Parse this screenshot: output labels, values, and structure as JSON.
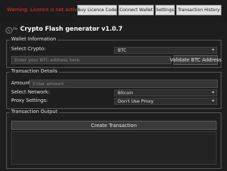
{
  "topbar": {
    "warning_text": "Warning: Licence is not activated",
    "buttons": [
      "Buy Licence Code",
      "Connect Wallet",
      "Settings",
      "Transaction History"
    ]
  },
  "header": {
    "logo_text": "lo",
    "logo_suffix": "Po",
    "title": "Crypto Flash generator v1.0.7"
  },
  "wallet": {
    "section_title": "Wallet Information",
    "select_crypto_label": "Select Crypto:",
    "crypto_value": "BTC",
    "address_placeholder": "Enter your BTC address here",
    "validate_label": "Validate BTC Address"
  },
  "transaction": {
    "section_title": "Transaction Details",
    "amount_label": "Amount:",
    "amount_placeholder": "Enter amount",
    "network_label": "Select Network:",
    "network_value": "Bitcoin",
    "proxy_label": "Proxy Settings:",
    "proxy_value": "Don't Use Proxy"
  },
  "output": {
    "section_title": "Transaction Output",
    "create_label": "Create Transaction"
  },
  "colors": {
    "background": "#1e1e1e",
    "warning": "#ff2a2a",
    "title": "#ffffff"
  }
}
